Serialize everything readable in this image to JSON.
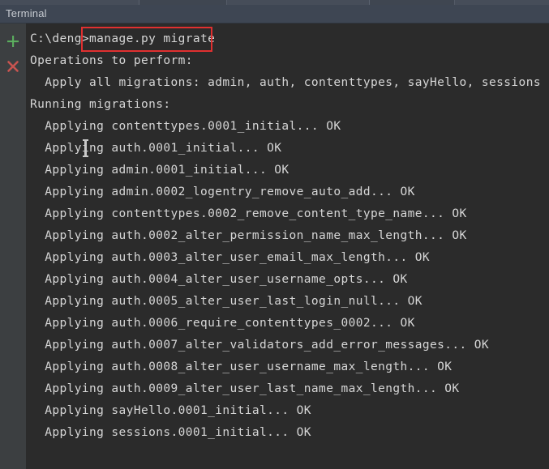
{
  "window": {
    "panel_title": "Terminal"
  },
  "toolbar": {
    "add_icon": "plus-icon",
    "close_icon": "close-icon",
    "accent_add_color": "#4f9a52",
    "accent_close_color": "#c75450"
  },
  "annotation": {
    "highlight_color": "#e03030",
    "highlighted_text": "manage.py migrate"
  },
  "cursor": {
    "type": "i-beam",
    "color": "#c9c9c9"
  },
  "terminal": {
    "prompt": "C:\\deng>",
    "command": "manage.py migrate",
    "background_color": "#2b2b2b",
    "text_color": "#d6d6d6",
    "lines": [
      "C:\\deng>manage.py migrate",
      "Operations to perform:",
      "  Apply all migrations: admin, auth, contenttypes, sayHello, sessions",
      "Running migrations:",
      "  Applying contenttypes.0001_initial... OK",
      "  Applying auth.0001_initial... OK",
      "  Applying admin.0001_initial... OK",
      "  Applying admin.0002_logentry_remove_auto_add... OK",
      "  Applying contenttypes.0002_remove_content_type_name... OK",
      "  Applying auth.0002_alter_permission_name_max_length... OK",
      "  Applying auth.0003_alter_user_email_max_length... OK",
      "  Applying auth.0004_alter_user_username_opts... OK",
      "  Applying auth.0005_alter_user_last_login_null... OK",
      "  Applying auth.0006_require_contenttypes_0002... OK",
      "  Applying auth.0007_alter_validators_add_error_messages... OK",
      "  Applying auth.0008_alter_user_username_max_length... OK",
      "  Applying auth.0009_alter_user_last_name_max_length... OK",
      "  Applying sayHello.0001_initial... OK",
      "  Applying sessions.0001_initial... OK"
    ]
  }
}
